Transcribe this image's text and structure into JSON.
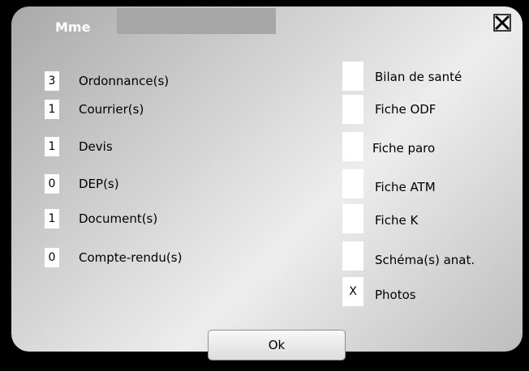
{
  "window": {
    "title": "Mme",
    "close_label": "X"
  },
  "documents": [
    {
      "count": "3",
      "label": "Ordonnance(s)"
    },
    {
      "count": "1",
      "label": "Courrier(s)"
    },
    {
      "count": "1",
      "label": "Devis"
    },
    {
      "count": "0",
      "label": "DEP(s)"
    },
    {
      "count": "1",
      "label": "Document(s)"
    },
    {
      "count": "0",
      "label": "Compte-rendu(s)"
    }
  ],
  "checks": [
    {
      "mark": "",
      "label": "Bilan de santé"
    },
    {
      "mark": "",
      "label": "Fiche ODF"
    },
    {
      "mark": "",
      "label": "Fiche paro"
    },
    {
      "mark": "",
      "label": "Fiche ATM"
    },
    {
      "mark": "",
      "label": "Fiche K"
    },
    {
      "mark": "",
      "label": "Schéma(s) anat."
    },
    {
      "mark": "X",
      "label": "Photos"
    }
  ],
  "ok_label": "Ok"
}
